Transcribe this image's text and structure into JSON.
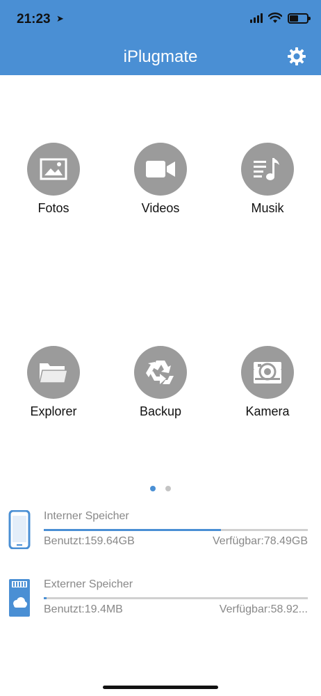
{
  "status_bar": {
    "time": "21:23",
    "location_arrow": "location-arrow-icon",
    "battery_level": 0.5
  },
  "header": {
    "title": "iPlugmate",
    "settings_icon": "gear-icon",
    "color": "#4a8fd4"
  },
  "grid": [
    {
      "label": "Fotos",
      "icon": "photo-icon"
    },
    {
      "label": "Videos",
      "icon": "video-camera-icon"
    },
    {
      "label": "Musik",
      "icon": "music-icon"
    },
    {
      "label": "Explorer",
      "icon": "folder-icon"
    },
    {
      "label": "Backup",
      "icon": "recycle-icon"
    },
    {
      "label": "Kamera",
      "icon": "camera-icon"
    }
  ],
  "pager": {
    "pages": 2,
    "current": 1
  },
  "storage": [
    {
      "name": "Interner Speicher",
      "used": "Benutzt:159.64GB",
      "available": "Verfügbar:78.49GB",
      "fraction_used": 0.67,
      "icon": "phone-icon"
    },
    {
      "name": "Externer Speicher",
      "used": "Benutzt:19.4MB",
      "available": "Verfügbar:58.92...",
      "fraction_used": 0.01,
      "icon": "sd-card-cloud-icon"
    }
  ]
}
